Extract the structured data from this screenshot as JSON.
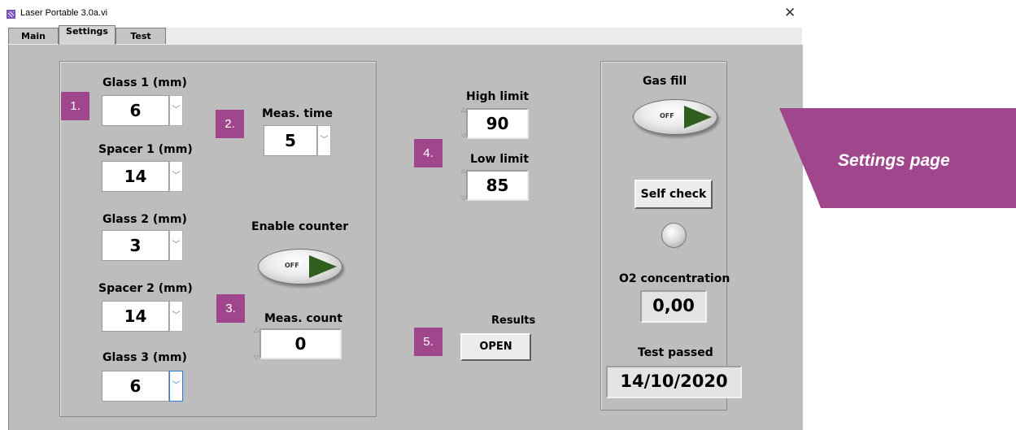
{
  "window": {
    "title": "Laser Portable 3.0a.vi"
  },
  "tabs": [
    {
      "label": "Main"
    },
    {
      "label": "Settings"
    },
    {
      "label": "Test"
    }
  ],
  "left_group": {
    "glass1": {
      "label": "Glass 1 (mm)",
      "value": "6"
    },
    "spacer1": {
      "label": "Spacer 1 (mm)",
      "value": "14"
    },
    "glass2": {
      "label": "Glass 2 (mm)",
      "value": "3"
    },
    "spacer2": {
      "label": "Spacer 2 (mm)",
      "value": "14"
    },
    "glass3": {
      "label": "Glass 3 (mm)",
      "value": "6"
    },
    "meas_time": {
      "label": "Meas. time",
      "value": "5"
    },
    "enable_counter": {
      "label": "Enable counter",
      "state": "OFF"
    },
    "meas_count": {
      "label": "Meas. count",
      "value": "0"
    }
  },
  "limits": {
    "high": {
      "label": "High limit",
      "value": "90"
    },
    "low": {
      "label": "Low limit",
      "value": "85"
    }
  },
  "results": {
    "label": "Results",
    "button": "OPEN"
  },
  "right_group": {
    "gas_fill": {
      "label": "Gas fill",
      "state": "OFF"
    },
    "self_check": "Self check",
    "o2": {
      "label": "O2 concentration",
      "value": "0,00"
    },
    "test_passed": {
      "label": "Test passed",
      "value": "14/10/2020"
    }
  },
  "steps": [
    "1.",
    "2.",
    "3.",
    "4.",
    "5."
  ],
  "callout": {
    "text": "Settings page"
  },
  "colors": {
    "accent": "#a0468c",
    "panel": "#bdbdbd"
  },
  "icons": {
    "ring_arrow": "chevron-down-icon",
    "spin_up": "triangle-up-icon",
    "spin_down": "triangle-down-icon"
  }
}
